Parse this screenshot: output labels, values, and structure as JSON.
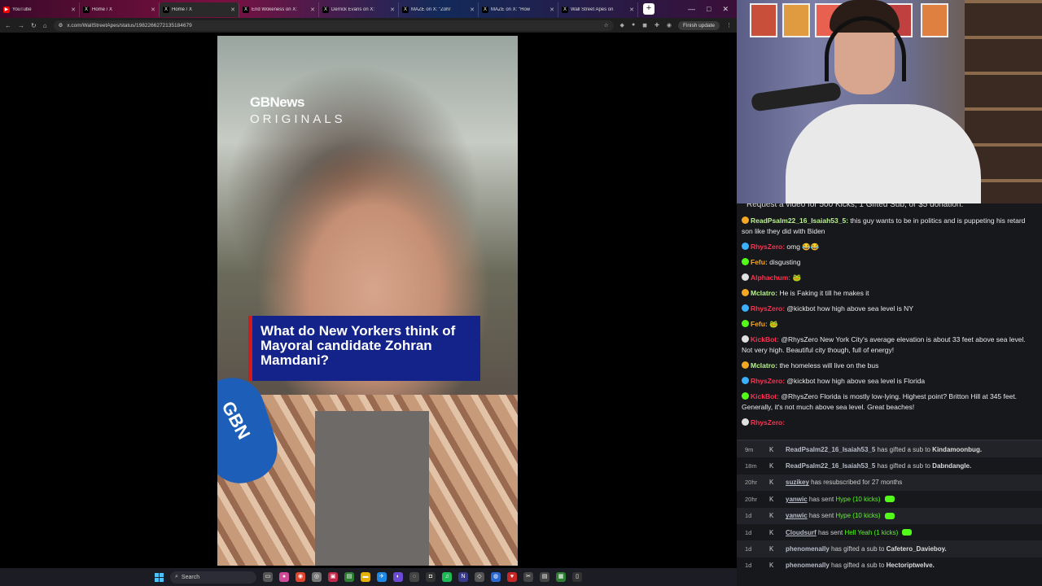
{
  "browser": {
    "tabs": [
      {
        "label": "YouTube",
        "icon": "youtube-icon",
        "color": "#ff0000",
        "glyph": "▶"
      },
      {
        "label": "Home / X",
        "icon": "x-logo-icon",
        "color": "#000000",
        "glyph": "X"
      },
      {
        "label": "Home / X",
        "icon": "x-logo-icon",
        "color": "#000000",
        "glyph": "X",
        "active": true
      },
      {
        "label": "End Wokeness on X:",
        "icon": "x-logo-icon",
        "color": "#000000",
        "glyph": "X"
      },
      {
        "label": "Derrick Evans on X:",
        "icon": "x-logo-icon",
        "color": "#000000",
        "glyph": "X"
      },
      {
        "label": "MAZE on X: \"Zohr",
        "icon": "x-logo-icon",
        "color": "#000000",
        "glyph": "X"
      },
      {
        "label": "MAZE on X: \"How",
        "icon": "x-logo-icon",
        "color": "#000000",
        "glyph": "X"
      },
      {
        "label": "Wall Street Apes on",
        "icon": "x-logo-icon",
        "color": "#000000",
        "glyph": "X"
      }
    ],
    "url": "x.com/WallStreetApes/status/1982266272135184679",
    "finish_update": "Finish update"
  },
  "video": {
    "brand": "GBNews",
    "brand_sub": "ORIGINALS",
    "caption": "What do New Yorkers think of Mayoral candidate Zohran Mamdani?",
    "mic_label": "GBN"
  },
  "chat": {
    "pinned": "Request a video for 500 Kicks, 1 Gifted Sub, or $5 donation.",
    "messages": [
      {
        "user": "ReadPsalm22_16_Isaiah53_5:",
        "color": "#b9f18c",
        "text": "this guy wants to be in politics and is puppeting his retard son like they did with Biden"
      },
      {
        "user": "RhysZero:",
        "color": "#ff2f4f",
        "text": "omg 😂😂"
      },
      {
        "user": "Fefu:",
        "color": "#f5a623",
        "text": "disgusting"
      },
      {
        "user": "Alphachum:",
        "color": "#ff2f4f",
        "text": "🐸"
      },
      {
        "user": "Mclatro:",
        "color": "#b9f18c",
        "text": "He is Faking it till he makes it"
      },
      {
        "user": "RhysZero:",
        "color": "#ff2f4f",
        "text": "@kickbot how high above sea level is NY"
      },
      {
        "user": "Fefu:",
        "color": "#f5a623",
        "text": "🐸"
      },
      {
        "user": "KickBot:",
        "color": "#ff2f4f",
        "text": "@RhysZero New York City's average elevation is about 33 feet above sea level. Not very high. Beautiful city though, full of energy!"
      },
      {
        "user": "Mclatro:",
        "color": "#b9f18c",
        "text": "the homeless will live on the bus"
      },
      {
        "user": "RhysZero:",
        "color": "#ff2f4f",
        "text": "@kickbot how high above sea level is Florida"
      },
      {
        "user": "KickBot:",
        "color": "#ff2f4f",
        "text": "@RhysZero Florida is mostly low-lying. Highest point? Britton Hill at 345 feet. Generally, it's not much above sea level. Great beaches!"
      },
      {
        "user": "RhysZero:",
        "color": "#ff2f4f",
        "text": ""
      }
    ]
  },
  "events": [
    {
      "time": "9m",
      "name": "ReadPsalm22_16_Isaiah53_5",
      "action": "has gifted a sub to",
      "target": "Kindamoonbug."
    },
    {
      "time": "18m",
      "name": "ReadPsalm22_16_Isaiah53_5",
      "action": "has gifted a sub to",
      "target": "Dabndangle."
    },
    {
      "time": "20hr",
      "name": "suzikey",
      "action": "has resubscribed for 27 months",
      "target": ""
    },
    {
      "time": "20hr",
      "name": "yanwic",
      "action": "has sent",
      "hl": "Hype (10 kicks)",
      "gift": true
    },
    {
      "time": "1d",
      "name": "yanwic",
      "action": "has sent",
      "hl": "Hype (10 kicks)",
      "gift": true
    },
    {
      "time": "1d",
      "name": "Cloudsurf",
      "action": "has sent",
      "hl": "Hell Yeah (1 kicks)",
      "gift": true
    },
    {
      "time": "1d",
      "name": "phenomenally",
      "action": "has gifted a sub to",
      "target": "Cafetero_Davieboy."
    },
    {
      "time": "1d",
      "name": "phenomenally",
      "action": "has gifted a sub to",
      "target": "Hectoriptwelve."
    }
  ],
  "taskbar": {
    "search_label": "Search"
  },
  "colors": {
    "kick_green": "#53fc18",
    "caption_bg": "#13238a",
    "caption_accent": "#d21a1a"
  }
}
